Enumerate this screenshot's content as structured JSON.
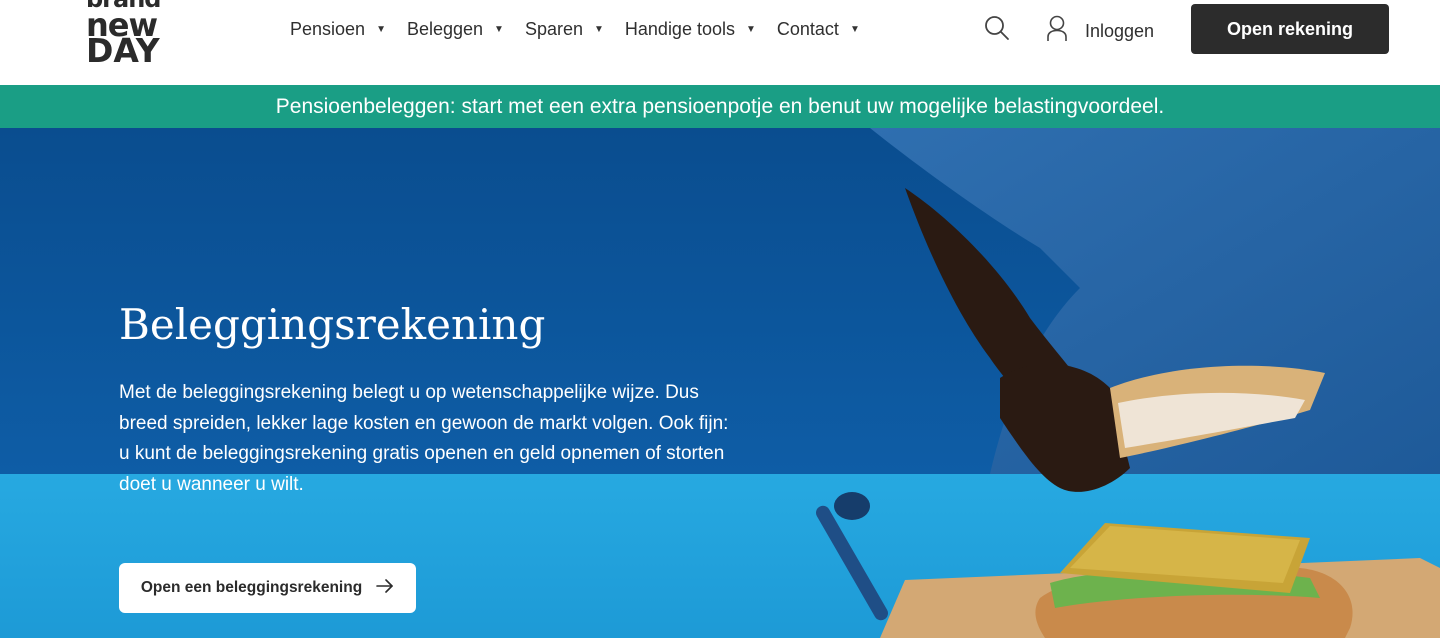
{
  "header": {
    "logo": {
      "line1": "brand",
      "line2": "new",
      "line3": "DAY"
    },
    "nav": [
      {
        "label": "Pensioen",
        "caret": "▼"
      },
      {
        "label": "Beleggen",
        "caret": "▼"
      },
      {
        "label": "Sparen",
        "caret": "▼"
      },
      {
        "label": "Handige tools",
        "caret": "▼"
      },
      {
        "label": "Contact",
        "caret": "▼"
      }
    ],
    "search_icon": "search-icon",
    "login_label": "Inloggen",
    "login_icon": "user-icon",
    "open_account_label": "Open rekening"
  },
  "banner": {
    "text": "Pensioenbeleggen: start met een extra pensioenpotje en benut uw mogelijke belastingvoordeel."
  },
  "hero": {
    "title": "Beleggingsrekening",
    "text": "Met de beleggingsrekening belegt u op wetenschappelijke wijze. Dus breed spreiden, lekker lage kosten en gewoon de markt volgen. Ook fijn: u kunt de beleggingsrekening gratis openen en geld opnemen of storten doet u wanneer u wilt.",
    "cta_label": "Open een beleggingsrekening",
    "cta_icon": "arrow-right-icon"
  },
  "colors": {
    "banner": "#1a9e85",
    "hero_dark": "#0d5aa0",
    "hero_light": "#1fa3dc",
    "button_dark": "#2c2c2c"
  }
}
